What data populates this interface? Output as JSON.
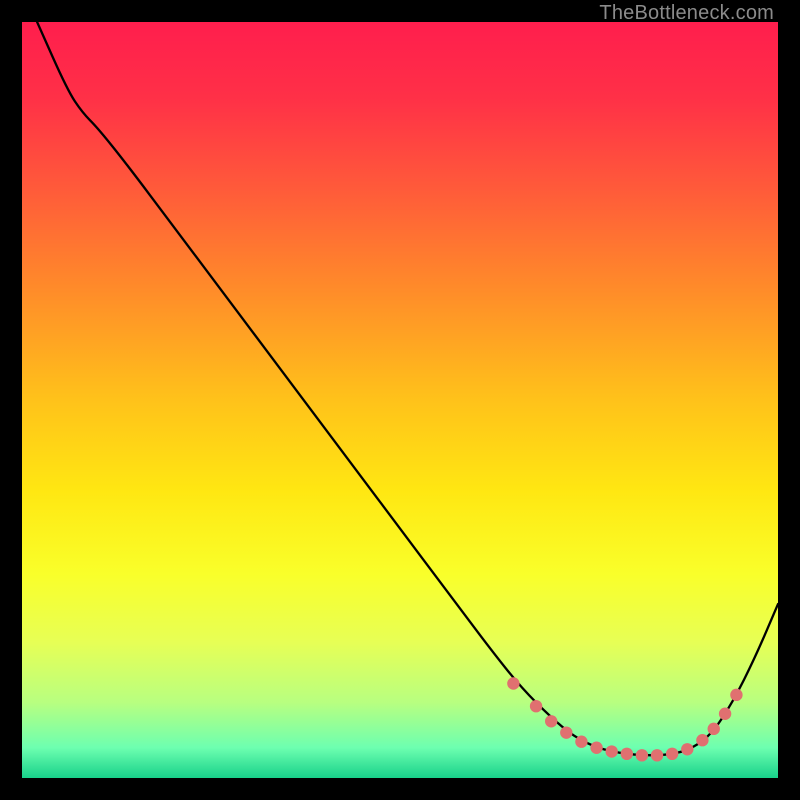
{
  "watermark": "TheBottleneck.com",
  "chart_data": {
    "type": "line",
    "title": "",
    "xlabel": "",
    "ylabel": "",
    "xlim": [
      0,
      100
    ],
    "ylim": [
      0,
      100
    ],
    "grid": false,
    "legend": false,
    "background_gradient_stops": [
      {
        "offset": 0.0,
        "color": "#ff1e4d"
      },
      {
        "offset": 0.1,
        "color": "#ff3047"
      },
      {
        "offset": 0.22,
        "color": "#ff5a3a"
      },
      {
        "offset": 0.35,
        "color": "#ff8a2a"
      },
      {
        "offset": 0.5,
        "color": "#ffc21a"
      },
      {
        "offset": 0.62,
        "color": "#ffe712"
      },
      {
        "offset": 0.73,
        "color": "#f9ff2a"
      },
      {
        "offset": 0.82,
        "color": "#e7ff55"
      },
      {
        "offset": 0.9,
        "color": "#b8ff80"
      },
      {
        "offset": 0.96,
        "color": "#6dffb0"
      },
      {
        "offset": 1.0,
        "color": "#18d18a"
      }
    ],
    "series": [
      {
        "name": "bottleneck-curve",
        "stroke": "#000000",
        "stroke_width": 2.3,
        "x": [
          2,
          6,
          8,
          10,
          14,
          20,
          26,
          32,
          38,
          44,
          50,
          56,
          62,
          66,
          70,
          73,
          76,
          79,
          82,
          85,
          88,
          91,
          94,
          97,
          100
        ],
        "y": [
          100,
          91,
          88,
          86,
          81,
          73,
          65,
          57,
          49,
          41,
          33,
          25,
          17,
          12,
          8,
          5.5,
          4,
          3.3,
          3,
          3,
          3.6,
          5.5,
          10,
          16,
          23
        ]
      }
    ],
    "markers": {
      "name": "curve-dots",
      "color": "#e07070",
      "radius": 6.2,
      "points": [
        {
          "x": 65,
          "y": 12.5
        },
        {
          "x": 68,
          "y": 9.5
        },
        {
          "x": 70,
          "y": 7.5
        },
        {
          "x": 72,
          "y": 6.0
        },
        {
          "x": 74,
          "y": 4.8
        },
        {
          "x": 76,
          "y": 4.0
        },
        {
          "x": 78,
          "y": 3.5
        },
        {
          "x": 80,
          "y": 3.2
        },
        {
          "x": 82,
          "y": 3.0
        },
        {
          "x": 84,
          "y": 3.0
        },
        {
          "x": 86,
          "y": 3.2
        },
        {
          "x": 88,
          "y": 3.8
        },
        {
          "x": 90,
          "y": 5.0
        },
        {
          "x": 91.5,
          "y": 6.5
        },
        {
          "x": 93,
          "y": 8.5
        },
        {
          "x": 94.5,
          "y": 11.0
        }
      ]
    }
  }
}
